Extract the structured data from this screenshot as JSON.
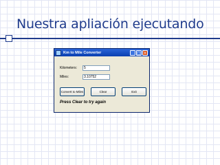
{
  "slide": {
    "title": "Nuestra apliación ejecutando"
  },
  "window": {
    "title": "Km to Mile Converter",
    "controls": {
      "minimize": "_",
      "maximize": "□",
      "close": "×"
    }
  },
  "form": {
    "km_label": "Kilometers:",
    "km_value": "5",
    "miles_label": "Miles:",
    "miles_value": "3.10752"
  },
  "buttons": {
    "convert": "Convert to Miles",
    "clear": "Clear",
    "exit": "Exit"
  },
  "status_text": "Press Clear to try again"
}
